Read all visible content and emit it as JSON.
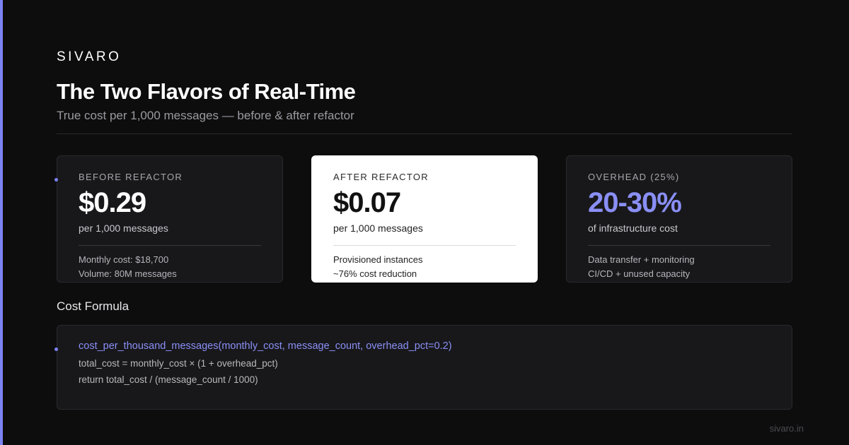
{
  "brand": "SIVARO",
  "header": {
    "title": "The Two Flavors of Real-Time",
    "subtitle": "True cost per 1,000 messages — before & after refactor"
  },
  "cards": [
    {
      "label": "BEFORE REFACTOR",
      "value": "$0.29",
      "unit": "per 1,000 messages",
      "notes": [
        "Monthly cost: $18,700",
        "Volume: 80M messages"
      ]
    },
    {
      "label": "AFTER REFACTOR",
      "value": "$0.07",
      "unit": "per 1,000 messages",
      "notes": [
        "Provisioned instances",
        "~76% cost reduction"
      ]
    },
    {
      "label": "OVERHEAD (25%)",
      "value": "20-30%",
      "unit": "of infrastructure cost",
      "notes": [
        "Data transfer + monitoring",
        "CI/CD + unused capacity"
      ]
    }
  ],
  "formula": {
    "section_title": "Cost Formula",
    "signature": "cost_per_thousand_messages(monthly_cost, message_count, overhead_pct=0.2)",
    "lines": [
      "total_cost = monthly_cost × (1 + overhead_pct)",
      "return total_cost / (message_count / 1000)"
    ]
  },
  "footer": "sivaro.in",
  "colors": {
    "background": "#0d0d0e",
    "accent": "#7c83f2",
    "card_dark": "#18181b",
    "card_light": "#ffffff"
  }
}
